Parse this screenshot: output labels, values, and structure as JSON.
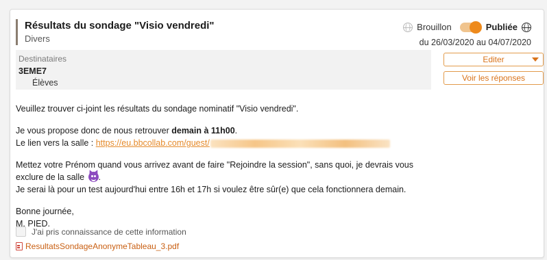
{
  "post": {
    "title": "Résultats du sondage \"Visio vendredi\"",
    "category": "Divers"
  },
  "status": {
    "draft_label": "Brouillon",
    "published_label": "Publiée",
    "published": true,
    "date_range": "du 26/03/2020 au 04/07/2020",
    "accent_color": "#ee8a1c"
  },
  "recipients": {
    "label": "Destinataires",
    "class_name": "3EME7",
    "role": "Élèves"
  },
  "actions": {
    "edit_label": "Editer",
    "view_replies_label": "Voir les réponses"
  },
  "message": {
    "line1": "Veuillez trouver ci-joint les résultats du sondage nominatif \"Visio vendredi\".",
    "line2_prefix": "Je vous propose donc de nous retrouver ",
    "line2_bold": "demain à 11h00",
    "line2_suffix": ".",
    "line3_prefix": "Le lien vers la salle : ",
    "link_text": "https://eu.bbcollab.com/guest/",
    "line4a": "Mettez votre Prénom quand vous arrivez avant de faire \"Rejoindre la session\", sans quoi, je devrais vous",
    "line4b": "exclure de la salle",
    "line4b_end": ".",
    "line5": "Je serai là pour un test aujourd'hui entre 16h et 17h si voulez être sûr(e) que cela fonctionnera demain.",
    "closing": "Bonne journée,",
    "signature": "M. PIED."
  },
  "acknowledge": {
    "label": "J'ai pris connaissance de cette information",
    "checked": false
  },
  "attachment": {
    "file_name": "ResultatsSondageAnonymeTableau_3.pdf",
    "icon": "pdf-icon"
  }
}
